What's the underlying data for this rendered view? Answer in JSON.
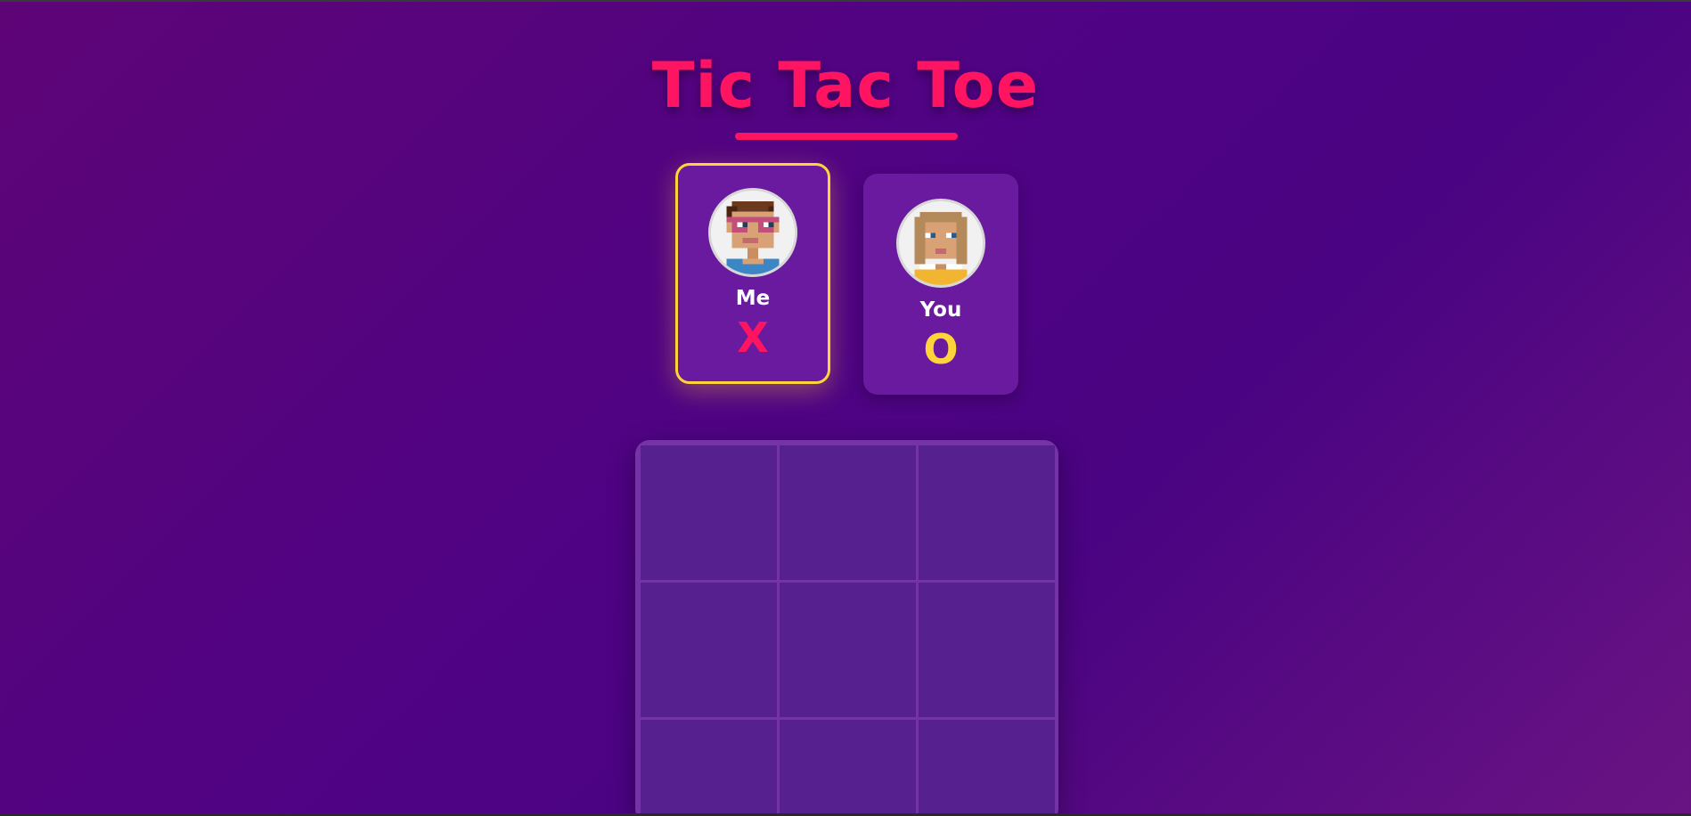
{
  "title": "Tic Tac Toe",
  "colors": {
    "accent": "#ff1461",
    "highlight": "#ffd43b",
    "card": "#6a1a9e",
    "cell": "#56208f",
    "board": "#7434a7"
  },
  "players": [
    {
      "name": "Me",
      "symbol": "X",
      "avatar": "pixel-boy-glasses-avatar",
      "active": true
    },
    {
      "name": "You",
      "symbol": "O",
      "avatar": "pixel-girl-avatar",
      "active": false
    }
  ],
  "board": {
    "cells": [
      "",
      "",
      "",
      "",
      "",
      "",
      "",
      "",
      ""
    ]
  }
}
